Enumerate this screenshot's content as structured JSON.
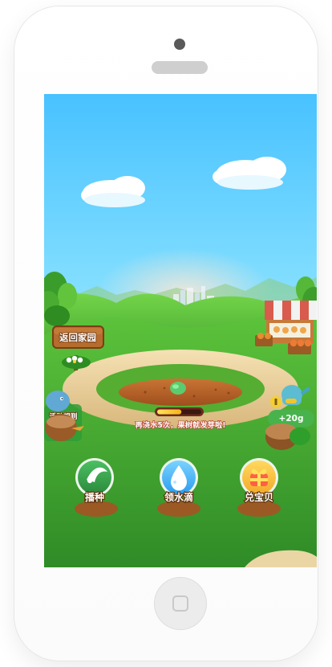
{
  "screen": {
    "back_home_label": "返回家园",
    "activity_rules_label": "活动规则",
    "water_hint_label": "再浇水5次，果树就发芽啦!",
    "reward_label": "+20g",
    "progress": 0.55,
    "actions": [
      {
        "label": "播种",
        "icon": "seed-icon"
      },
      {
        "label": "领水滴",
        "icon": "water-drop-icon"
      },
      {
        "label": "兑宝贝",
        "icon": "gift-icon"
      }
    ]
  },
  "colors": {
    "sky_top": "#4fc8ff",
    "sky_bottom": "#d8fbff",
    "grass": "#48ad2e",
    "grass_dark": "#2f8e23",
    "soil": "#b25f24",
    "sand": "#ead6a5",
    "wood": "#b56c2d",
    "green_badge": "#34a14a",
    "blue_badge": "#4ab8ff",
    "gold_badge": "#f8c332"
  }
}
